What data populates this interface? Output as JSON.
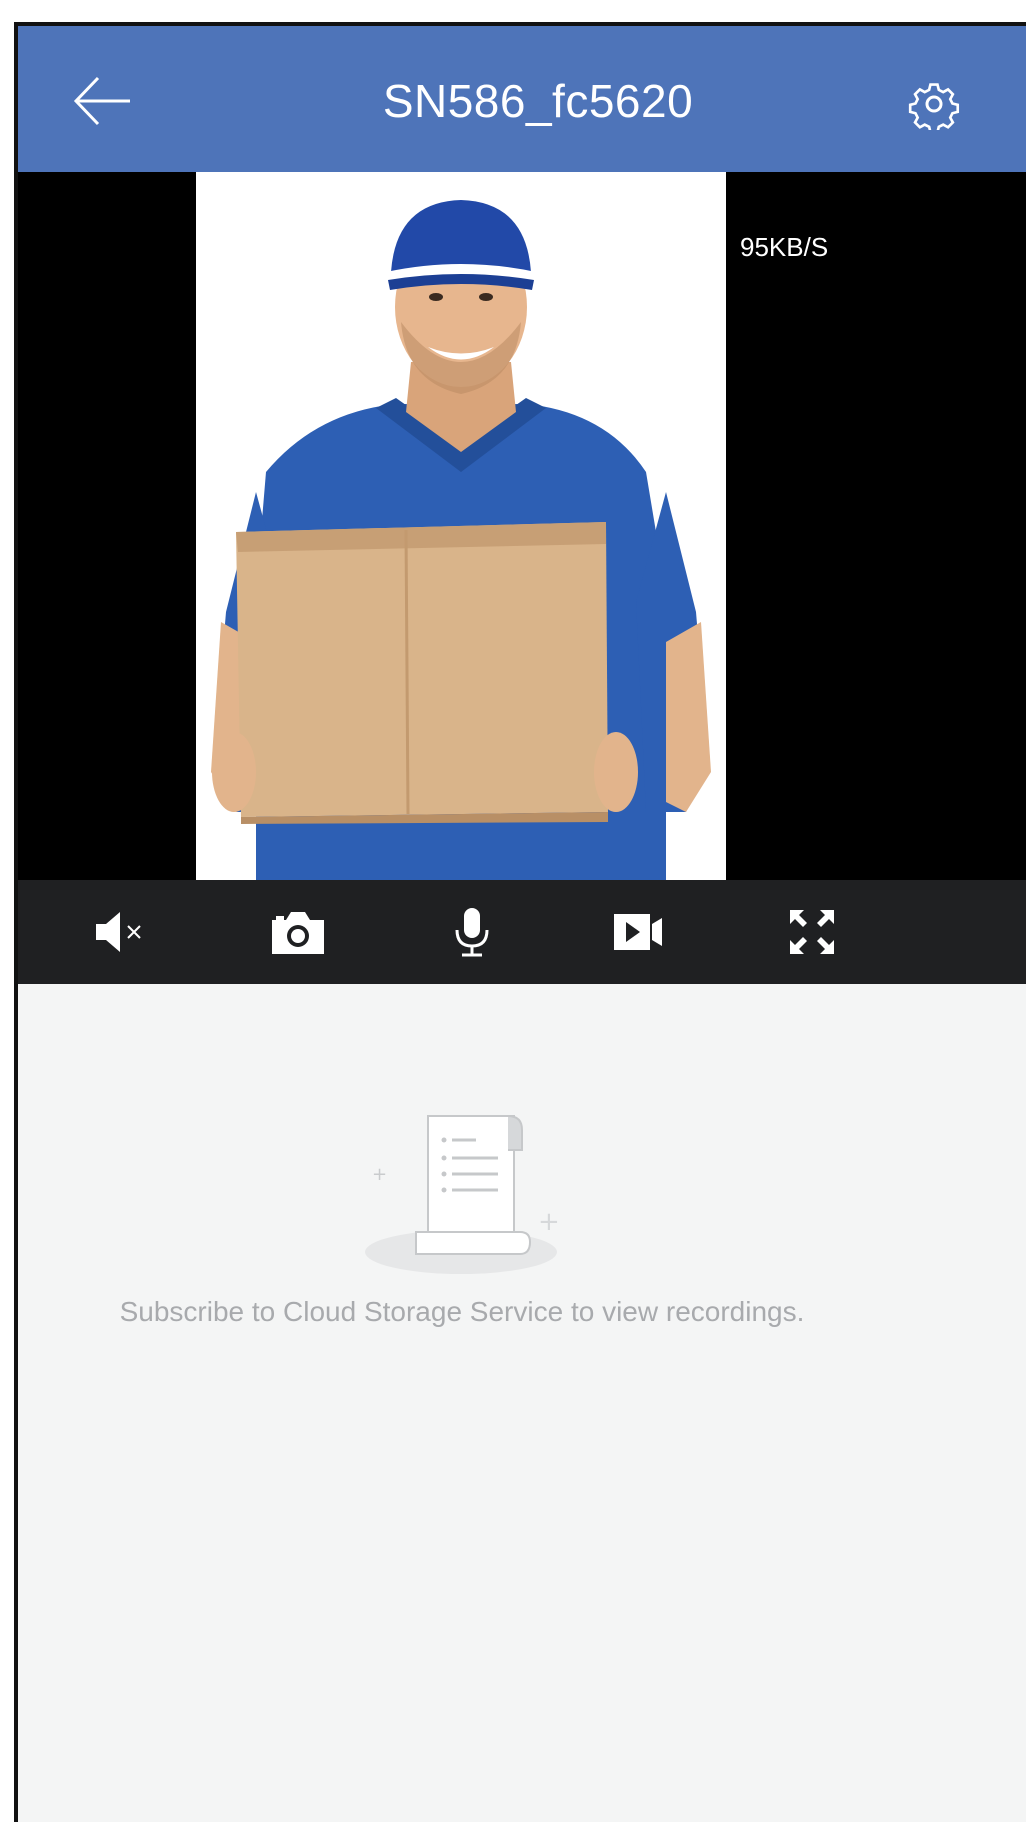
{
  "header": {
    "title": "SN586_fc5620",
    "back_icon": "arrow-left-icon",
    "settings_icon": "gear-icon",
    "background_color": "#4e74b9"
  },
  "video": {
    "bitrate": "95KB/S",
    "subject": "delivery person in blue cap and polo holding a cardboard box"
  },
  "controls": {
    "items": [
      {
        "name": "mute",
        "icon": "speaker-muted-icon"
      },
      {
        "name": "snapshot",
        "icon": "camera-icon"
      },
      {
        "name": "talk",
        "icon": "microphone-icon"
      },
      {
        "name": "record",
        "icon": "video-record-icon"
      },
      {
        "name": "fullscreen",
        "icon": "fullscreen-icon"
      }
    ],
    "background_color": "#1f2022"
  },
  "cloud": {
    "illustration_icon": "receipt-scroll-icon",
    "message": "Subscribe to Cloud Storage Service to view recordings."
  }
}
